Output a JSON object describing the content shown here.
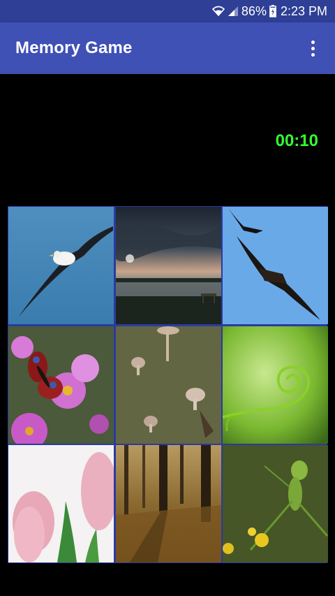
{
  "status_bar": {
    "battery": "86%",
    "time": "2:23 PM",
    "icons": [
      "wifi-icon",
      "signal-icon",
      "battery-icon"
    ]
  },
  "app_bar": {
    "title": "Memory Game",
    "menu_icon": "overflow-menu-icon"
  },
  "game": {
    "timer": "00:10",
    "timer_color": "#33ff33",
    "tiles": [
      {
        "name": "albatross"
      },
      {
        "name": "lake-dusk"
      },
      {
        "name": "eagle"
      },
      {
        "name": "butterfly"
      },
      {
        "name": "mushrooms"
      },
      {
        "name": "tendril"
      },
      {
        "name": "tulips"
      },
      {
        "name": "forest"
      },
      {
        "name": "mantis"
      }
    ]
  },
  "colors": {
    "status_bar_bg": "#2e3f95",
    "app_bar_bg": "#3f51b5",
    "grid_border": "#2b3aa0"
  }
}
